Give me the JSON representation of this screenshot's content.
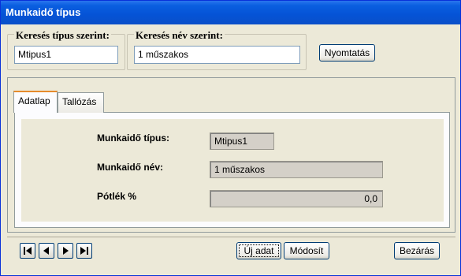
{
  "window": {
    "title": "Munkaidő típus"
  },
  "search": {
    "by_type_label": "Keresés típus szerint:",
    "by_type_value": "Mtipus1",
    "by_name_label": "Keresés név szerint:",
    "by_name_value": "1 műszakos",
    "print_button": "Nyomtatás"
  },
  "tabs": [
    {
      "label": "Adatlap",
      "active": true
    },
    {
      "label": "Tallózás",
      "active": false
    }
  ],
  "form": {
    "type_label": "Munkaidő típus:",
    "type_value": "Mtipus1",
    "name_label": "Munkaidő név:",
    "name_value": "1 műszakos",
    "bonus_label": "Pótlék %",
    "bonus_value": "0,0"
  },
  "footer": {
    "new_button": "Új adat",
    "modify_button": "Módosít",
    "close_button": "Bezárás"
  },
  "nav_icons": [
    "first-record-icon",
    "prev-record-icon",
    "next-record-icon",
    "last-record-icon"
  ]
}
